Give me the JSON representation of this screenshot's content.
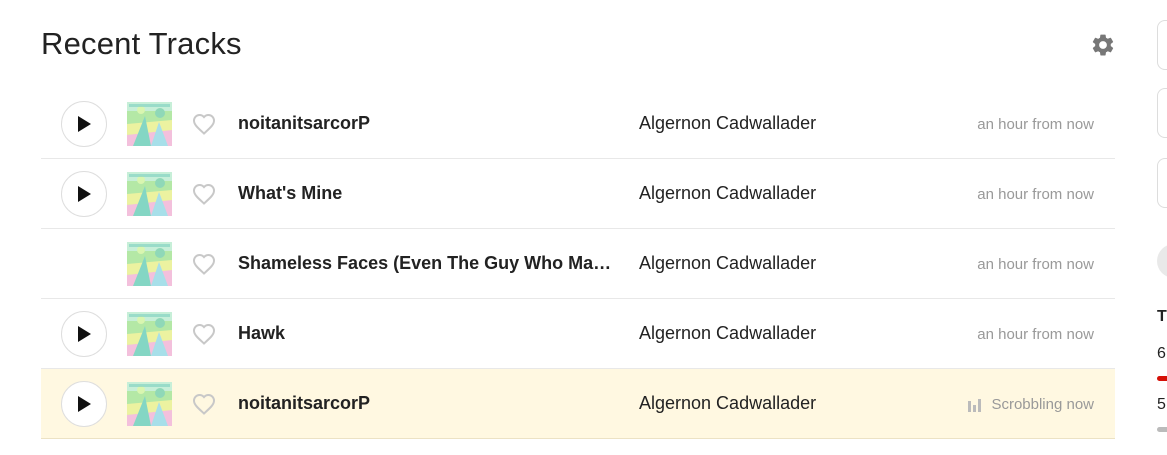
{
  "section": {
    "title": "Recent Tracks"
  },
  "tracks": [
    {
      "name": "noitanitsarcorP",
      "artist": "Algernon Cadwallader",
      "time": "an hour from now",
      "playable": true,
      "now_playing": false
    },
    {
      "name": "What's Mine",
      "artist": "Algernon Cadwallader",
      "time": "an hour from now",
      "playable": true,
      "now_playing": false
    },
    {
      "name": "Shameless Faces (Even The Guy Who Made Pizza Rolls)",
      "artist": "Algernon Cadwallader",
      "time": "an hour from now",
      "playable": false,
      "now_playing": false
    },
    {
      "name": "Hawk",
      "artist": "Algernon Cadwallader",
      "time": "an hour from now",
      "playable": true,
      "now_playing": false
    },
    {
      "name": "noitanitsarcorP",
      "artist": "Algernon Cadwallader",
      "time": "Scrobbling now",
      "playable": true,
      "now_playing": true
    }
  ],
  "sidebar": {
    "label": "T",
    "values": [
      "6",
      "5"
    ]
  },
  "colors": {
    "now_playing_bg": "#fff8e1",
    "accent_red": "#d51007",
    "muted_text": "#999999"
  },
  "icons": {
    "settings": "gear-icon",
    "play": "play-icon",
    "love": "heart-outline-icon",
    "scrobbling": "equalizer-icon"
  }
}
